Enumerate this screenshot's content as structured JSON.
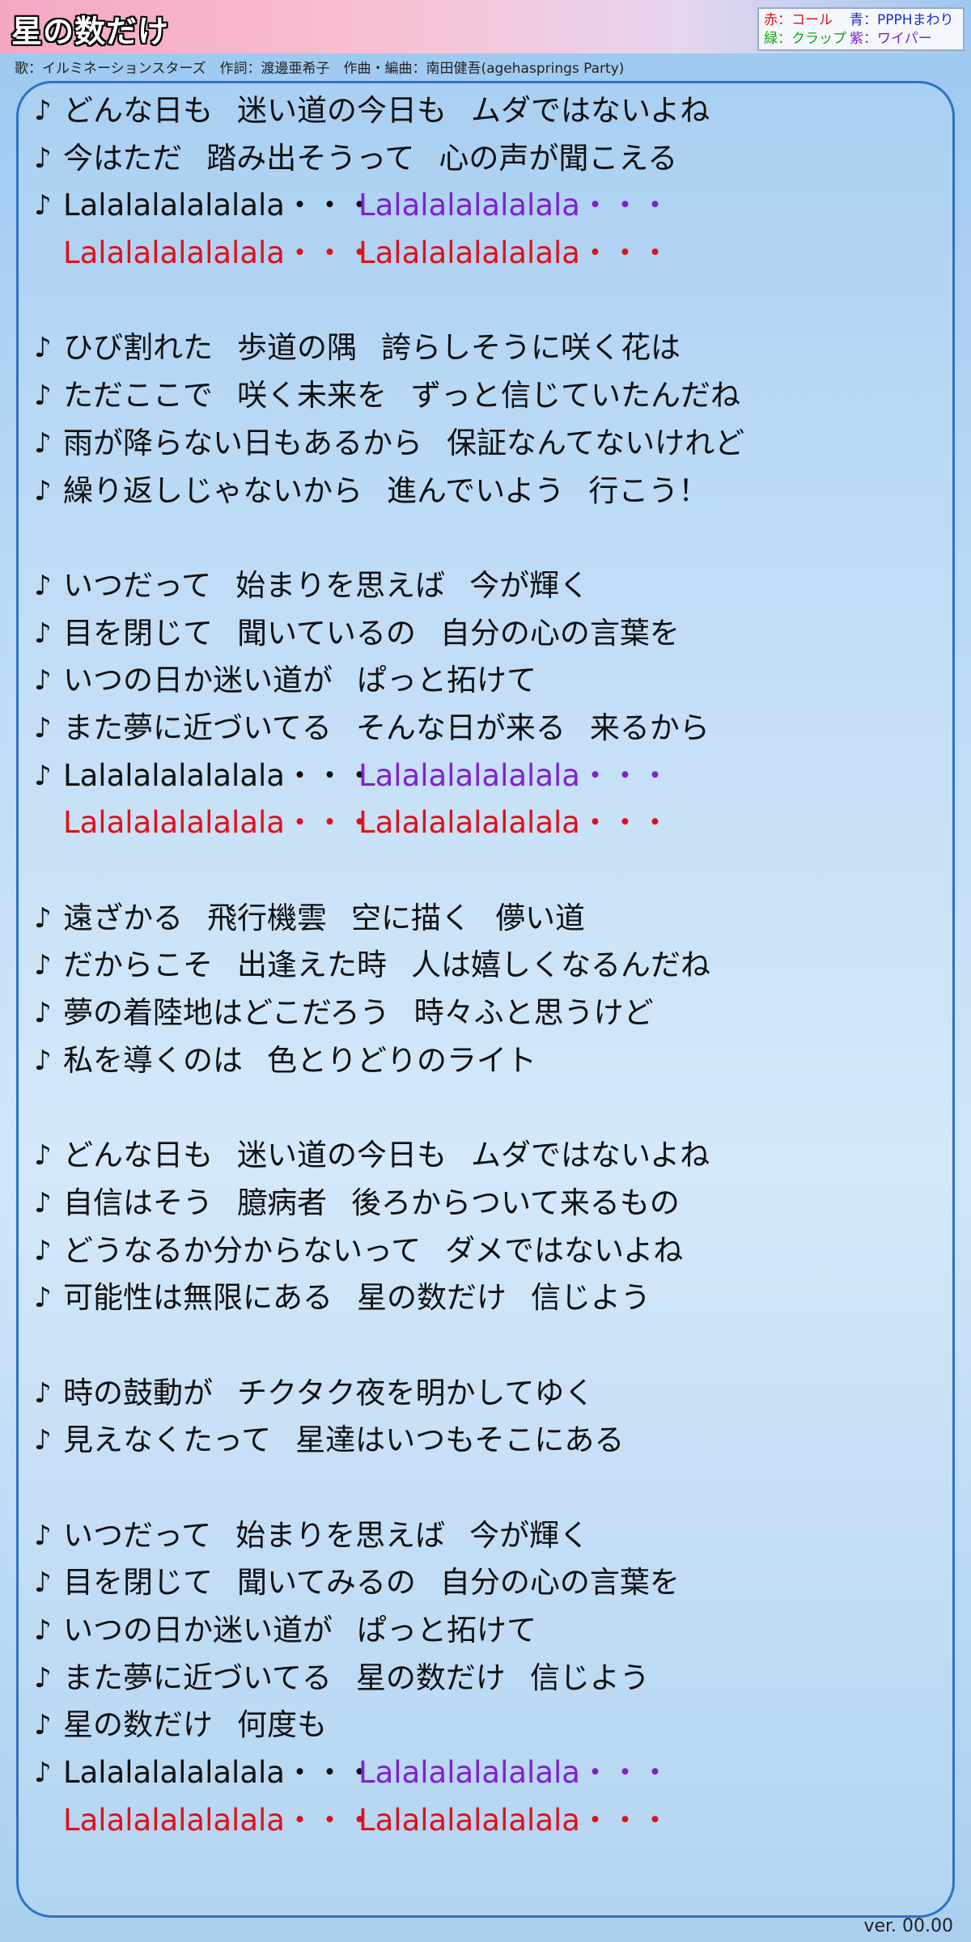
{
  "title": "星の数だけ",
  "credits": "歌：イルミネーションスターズ　作詞：渡邊亜希子　作曲・編曲：南田健吾(agehasprings Party)",
  "legend": {
    "red": "赤：コール",
    "blue": "青：PPPHまわり",
    "green": "緑：クラップ",
    "purple": "紫：ワイパー"
  },
  "note_symbol": "♪",
  "lyrics": [
    [
      "どんな日も",
      "迷い道の今日も",
      "ムダではないよね"
    ],
    [
      "今はただ",
      "踏み出そうって",
      "心の声が聞こえる"
    ],
    [
      "Lalalalalalalala・・・",
      "Lalalalalalalala・・・"
    ],
    [
      "Lalalalalalalala・・・",
      "Lalalalalalalala・・・"
    ],
    [
      "ひび割れた",
      "歩道の隅",
      "誇らしそうに咲く花は"
    ],
    [
      "ただここで",
      "咲く未来を",
      "ずっと信じていたんだね"
    ],
    [
      "雨が降らない日もあるから",
      "保証なんてないけれど"
    ],
    [
      "繰り返しじゃないから",
      "進んでいよう",
      "行こう！"
    ],
    [
      "いつだって",
      "始まりを思えば",
      "今が輝く"
    ],
    [
      "目を閉じて",
      "聞いているの",
      "自分の心の言葉を"
    ],
    [
      "いつの日か迷い道が",
      "ぱっと拓けて"
    ],
    [
      "また夢に近づいてる",
      "そんな日が来る",
      "来るから"
    ],
    [
      "Lalalalalalalala・・・",
      "Lalalalalalalala・・・"
    ],
    [
      "Lalalalalalalala・・・",
      "Lalalalalalalala・・・"
    ],
    [
      "遠ざかる",
      "飛行機雲",
      "空に描く",
      "儚い道"
    ],
    [
      "だからこそ",
      "出逢えた時",
      "人は嬉しくなるんだね"
    ],
    [
      "夢の着陸地はどこだろう",
      "時々ふと思うけど"
    ],
    [
      "私を導くのは",
      "色とりどりのライト"
    ],
    [
      "どんな日も",
      "迷い道の今日も",
      "ムダではないよね"
    ],
    [
      "自信はそう",
      "臆病者",
      "後ろからついて来るもの"
    ],
    [
      "どうなるか分からないって",
      "ダメではないよね"
    ],
    [
      "可能性は無限にある",
      "星の数だけ",
      "信じよう"
    ],
    [
      "時の鼓動が",
      "チクタク夜を明かしてゆく"
    ],
    [
      "見えなくたって",
      "星達はいつもそこにある"
    ],
    [
      "いつだって",
      "始まりを思えば",
      "今が輝く"
    ],
    [
      "目を閉じて",
      "聞いてみるの",
      "自分の心の言葉を"
    ],
    [
      "いつの日か迷い道が",
      "ぱっと拓けて"
    ],
    [
      "また夢に近づいてる",
      "星の数だけ",
      "信じよう"
    ],
    [
      "星の数だけ",
      "何度も"
    ],
    [
      "Lalalalalalalala・・・",
      "Lalalalalalalala・・・"
    ],
    [
      "Lalalalalalalala・・・",
      "Lalalalalalalala・・・"
    ]
  ],
  "version": "ver. 00.00",
  "colors": {
    "call": "#e0101a",
    "ppph": "#1a2cd8",
    "clap": "#18a018",
    "wiper": "#8020d0",
    "panel_border": "#2e72c8"
  }
}
